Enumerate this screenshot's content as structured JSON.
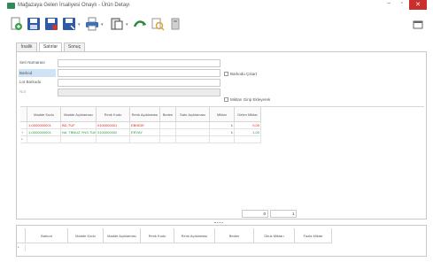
{
  "window": {
    "title": "Mağazaya Gelen İrsaliyesi Onaylı - Ürün Detayı",
    "min": "−",
    "max": "▫",
    "close": "✕"
  },
  "toolbar": {
    "buttons": [
      {
        "name": "new-document-icon",
        "color": "#3c9e4a"
      },
      {
        "name": "save-icon",
        "color": "#2f5aa8"
      },
      {
        "name": "save-red-icon",
        "color": "#2f5aa8"
      },
      {
        "name": "save-as-icon",
        "color": "#2f5aa8"
      },
      {
        "name": "print-icon",
        "color": "#3a6fc4"
      },
      {
        "name": "print-preview-icon",
        "color": "#4a4a4a"
      },
      {
        "name": "refresh-icon",
        "color": "#2d8a3c"
      },
      {
        "name": "search-icon",
        "color": "#d9a53a"
      },
      {
        "name": "export-icon",
        "color": "#9a9a9a"
      }
    ],
    "panel_icon": "window-icon"
  },
  "tabs": [
    "İrsalik",
    "Satırlar",
    "Sonuç"
  ],
  "form": {
    "labels": [
      "Seri Numarası",
      "Barkod",
      "Lot Barkodu",
      "Not"
    ],
    "checkbox_barcode": "Barkodu Çıkart",
    "checkbox_amount": "Miktarı Girip Ekleyerek"
  },
  "grid": {
    "headers": [
      "Madde Kodu",
      "Madde Açıklaması",
      "Renk Kodu",
      "Renk Açıklaması",
      "Beden",
      "Satır Açıklaması",
      "Miktar",
      "Gelen Miktar"
    ],
    "rows": [
      {
        "marker": "",
        "cells": [
          "1-0000000001",
          "BD-TUF",
          "0100000001",
          "EBHİDE",
          "",
          "",
          "1",
          "0,00"
        ],
        "color": "red"
      },
      {
        "marker": "+",
        "cells": [
          "1-0000000001",
          "Nd. TBNUZ YNS.TUK",
          "0100000002",
          "ERYAY",
          "",
          "",
          "1",
          "1,00"
        ],
        "color": "green"
      },
      {
        "marker": "*",
        "cells": [
          "",
          "",
          "",
          "",
          "",
          "",
          "",
          ""
        ],
        "color": ""
      }
    ]
  },
  "pager": {
    "left": "0",
    "right": "1"
  },
  "bottom_grid": {
    "headers": [
      "Barkod",
      "Madde Kodu",
      "Madde Açıklaması",
      "Renk Kodu",
      "Renk Açıklaması",
      "Beden",
      "Okuk Miktarı",
      "Fazla Miktar"
    ],
    "new_row_marker": "*"
  }
}
